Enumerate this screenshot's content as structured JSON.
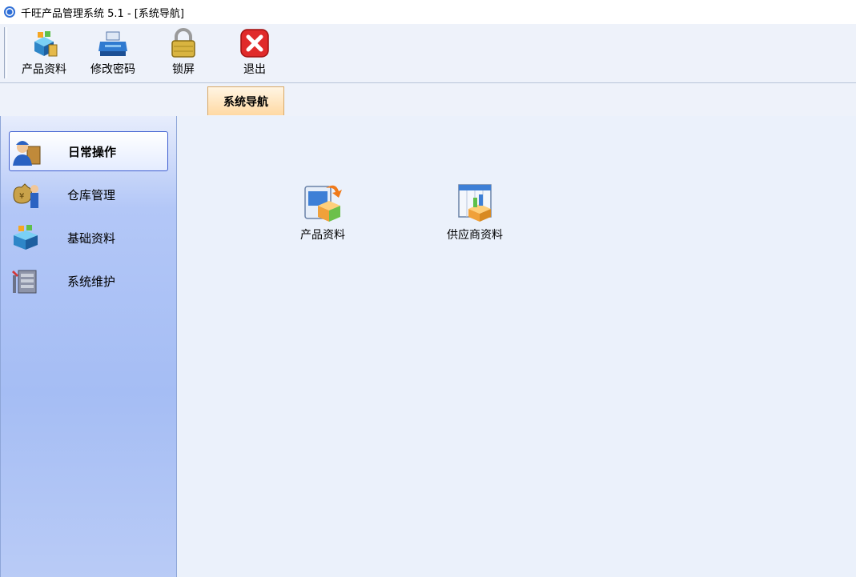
{
  "window": {
    "title": "千旺产品管理系统 5.1 - [系统导航]"
  },
  "toolbar": {
    "buttons": [
      {
        "label": "产品资料",
        "icon": "product-box-icon"
      },
      {
        "label": "修改密码",
        "icon": "printer-icon"
      },
      {
        "label": "锁屏",
        "icon": "padlock-icon"
      },
      {
        "label": "退出",
        "icon": "close-x-icon"
      }
    ]
  },
  "tabs": [
    {
      "label": "系统导航",
      "active": true
    }
  ],
  "sidebar": {
    "items": [
      {
        "label": "日常操作",
        "icon": "worker-icon",
        "active": true
      },
      {
        "label": "仓库管理",
        "icon": "money-bag-icon",
        "active": false
      },
      {
        "label": "基础资料",
        "icon": "product-box-icon",
        "active": false
      },
      {
        "label": "系统维护",
        "icon": "tools-icon",
        "active": false
      }
    ]
  },
  "main": {
    "items": [
      {
        "label": "产品资料",
        "icon": "product-export-icon"
      },
      {
        "label": "供应商资料",
        "icon": "supplier-calendar-icon"
      }
    ]
  },
  "colors": {
    "active_border": "#3f5fd0",
    "tab_fill": "#ffd9a3",
    "exit_red": "#e02a2a",
    "sidebar_blue": "#a5bdf4"
  }
}
